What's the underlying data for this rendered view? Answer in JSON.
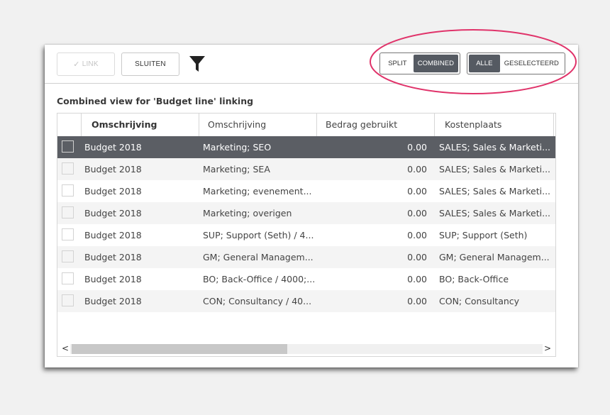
{
  "toolbar": {
    "link_label": "LINK",
    "close_label": "SLUITEN",
    "view_toggle": [
      "SPLIT",
      "COMBINED"
    ],
    "view_active": "COMBINED",
    "scope_toggle": [
      "ALLE",
      "GESELECTEERD"
    ],
    "scope_active": "ALLE"
  },
  "caption": "Combined view for 'Budget line' linking",
  "table": {
    "headers": [
      "Omschrijving",
      "Omschrijving",
      "Bedrag gebruikt",
      "Kostenplaats"
    ],
    "rows": [
      {
        "budget": "Budget 2018",
        "desc": "Marketing; SEO",
        "amount": "0.00",
        "cost": "SALES; Sales & Marketi...",
        "selected": true
      },
      {
        "budget": "Budget 2018",
        "desc": "Marketing; SEA",
        "amount": "0.00",
        "cost": "SALES; Sales & Marketi..."
      },
      {
        "budget": "Budget 2018",
        "desc": "Marketing; evenement...",
        "amount": "0.00",
        "cost": "SALES; Sales & Marketi..."
      },
      {
        "budget": "Budget 2018",
        "desc": "Marketing; overigen",
        "amount": "0.00",
        "cost": "SALES; Sales & Marketi..."
      },
      {
        "budget": "Budget 2018",
        "desc": "SUP; Support (Seth) / 4...",
        "amount": "0.00",
        "cost": "SUP; Support (Seth)"
      },
      {
        "budget": "Budget 2018",
        "desc": "GM; General Managem...",
        "amount": "0.00",
        "cost": "GM; General Managem..."
      },
      {
        "budget": "Budget 2018",
        "desc": "BO; Back-Office / 4000;...",
        "amount": "0.00",
        "cost": "BO; Back-Office"
      },
      {
        "budget": "Budget 2018",
        "desc": "CON; Consultancy / 40...",
        "amount": "0.00",
        "cost": "CON; Consultancy"
      }
    ]
  },
  "scroll": {
    "left_arrow": "<",
    "right_arrow": ">"
  },
  "icons": {
    "filter": "funnel-icon",
    "check": "checkmark-icon"
  },
  "colors": {
    "highlight_ellipse": "#e0336a",
    "selected_row": "#5b5e64",
    "active_toggle": "#555a62"
  }
}
